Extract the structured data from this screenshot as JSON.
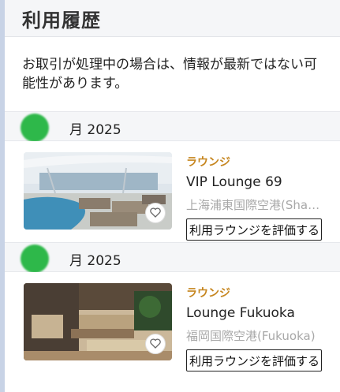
{
  "header": {
    "title": "利用履歴"
  },
  "notice": "お取引が処理中の場合は、情報が最新ではない可能性があります。",
  "groups": [
    {
      "date": "月 2025",
      "item": {
        "category": "ラウンジ",
        "name": "VIP Lounge 69",
        "location": "上海浦東国際空港(Shanghai)",
        "rate_label": "利用ラウンジを評価する"
      }
    },
    {
      "date": "月 2025",
      "item": {
        "category": "ラウンジ",
        "name": "Lounge Fukuoka",
        "location": "福岡国際空港(Fukuoka)",
        "rate_label": "利用ラウンジを評価する"
      }
    }
  ],
  "colors": {
    "accent": "#c6861f",
    "redaction": "#2eb84a",
    "rail": "#c8d3e6"
  }
}
